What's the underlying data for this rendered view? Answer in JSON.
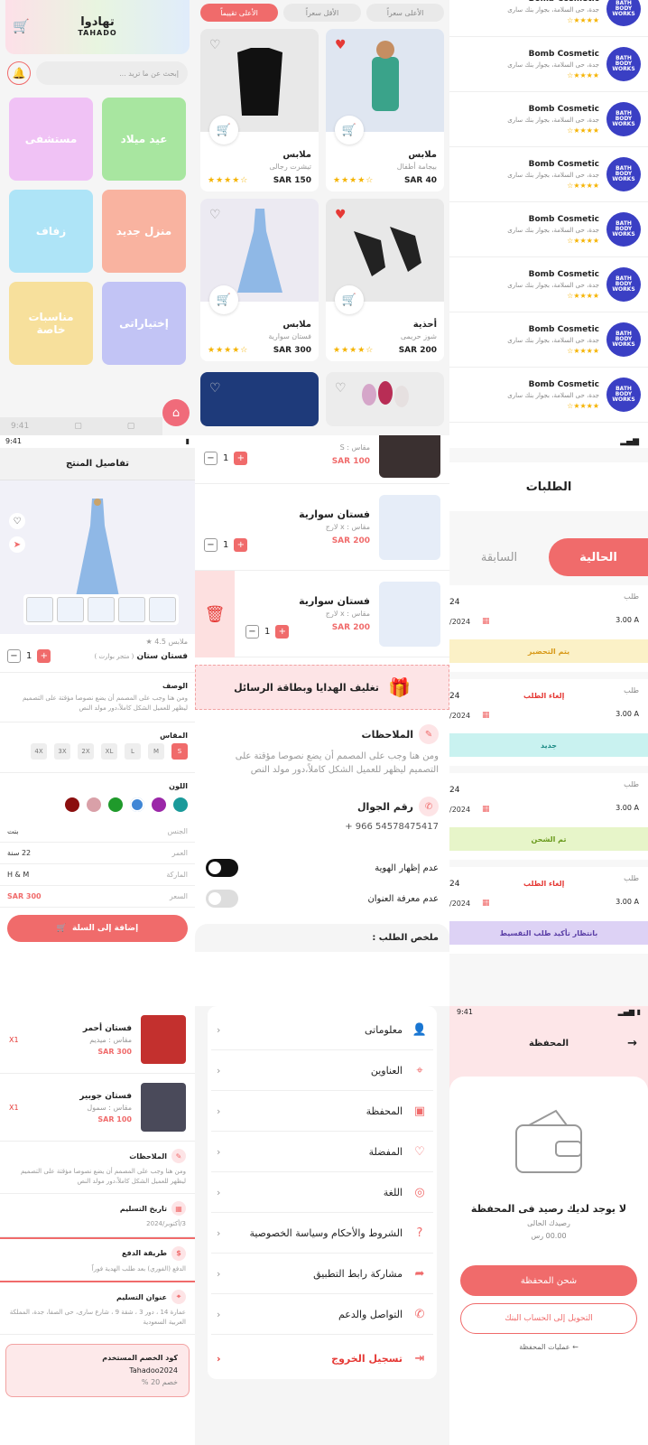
{
  "home": {
    "logo_ar": "تهادوا",
    "logo_en": "TAHADO",
    "search_placeholder": "إبحث عن ما تريد ...",
    "tiles": [
      {
        "label": "عيد ميلاد",
        "color": "#a8e6a0"
      },
      {
        "label": "مستشفى",
        "color": "#f0c2f5"
      },
      {
        "label": "منزل جديد",
        "color": "#f9b3a0"
      },
      {
        "label": "زفاف",
        "color": "#aee4f7"
      },
      {
        "label": "إختياراتى",
        "color": "#c2c4f5"
      },
      {
        "label": "مناسبات خاصة",
        "color": "#f7e09c"
      }
    ],
    "time": "9:41"
  },
  "products": {
    "chips": [
      "الأعلى سعراً",
      "الأقل سعراً",
      "الأعلى تقييماً"
    ],
    "items": [
      {
        "name": "ملابس",
        "sub": "بيجامة أطفال",
        "price": "SAR 40",
        "stars": "★★★★☆",
        "fav": true
      },
      {
        "name": "ملابس",
        "sub": "تيشرت رجالى",
        "price": "SAR 150",
        "stars": "★★★★☆",
        "fav": false
      },
      {
        "name": "أحذية",
        "sub": "شوز حريمى",
        "price": "SAR 200",
        "stars": "★★★★☆",
        "fav": true
      },
      {
        "name": "ملابس",
        "sub": "فستان سوارية",
        "price": "SAR 300",
        "stars": "★★★★☆",
        "fav": false
      }
    ]
  },
  "stores": {
    "name": "Bomb Cosmetic",
    "address": "جدة، حى السلامة، بجوار بنك سارى",
    "logo": "BATH BODY WORKS",
    "stars": "★★★★☆",
    "count": 8
  },
  "detail": {
    "time": "9:41",
    "title": "تفاصيل المنتج",
    "rating": "ملابس 4.5 ★",
    "product_name": "فستان ستان",
    "product_store": "( متجر بوارت )",
    "qty": "1",
    "desc_title": "الوصف",
    "desc": "ومن هنا وجب على المصمم أن يضع نصوصا مؤقتة على التصميم ليظهر للعميل الشكل كاملاً،دور مولد النص",
    "size_title": "المقاس",
    "sizes": [
      "S",
      "M",
      "L",
      "XL",
      "2X",
      "3X",
      "4X"
    ],
    "color_title": "اللون",
    "colors": [
      "#1a9a9a",
      "#9b27a8",
      "#3f86d6",
      "#1f9a2b",
      "#d9a0a8",
      "#8b0f0f"
    ],
    "attrs": [
      {
        "k": "الجنس",
        "v": "بنت"
      },
      {
        "k": "العمر",
        "v": "22 سنة"
      },
      {
        "k": "الماركة",
        "v": "H & M"
      },
      {
        "k": "السعر",
        "v": "SAR 300"
      }
    ],
    "add_button": "إضافة إلى السلة"
  },
  "cart": {
    "items": [
      {
        "name": "",
        "sub": "مقاس : S",
        "price": "SAR 100",
        "qty": "1"
      },
      {
        "name": "فستان سوارية",
        "sub": "مقاس : x لارج",
        "price": "SAR 200",
        "qty": "1"
      },
      {
        "name": "فستان سوارية",
        "sub": "مقاس : x لارج",
        "price": "SAR 200",
        "qty": "1"
      }
    ],
    "gift": "تغليف الهدايا وبطاقة الرسائل",
    "notes_title": "الملاحظات",
    "notes": "ومن هنا وجب على المصمم أن يضع نصوصا مؤقتة على التصميم ليظهر للعميل الشكل كاملاً،دور مولد النص",
    "phone_title": "رقم الجوال",
    "phone": "+ 966 54578475417",
    "hide_identity": "عدم إظهار الهوية",
    "unknown_address": "عدم معرفة العنوان",
    "summary_title": "ملخص الطلب :"
  },
  "orders": {
    "time": "",
    "title": "الطلبات",
    "tabs": [
      "الحالية",
      "السابقة"
    ],
    "cards": [
      {
        "label": "طلب",
        "amount": "3.00 A",
        "num": "24",
        "date": "/2024",
        "cancel": "",
        "status": "يتم التحضير",
        "status_bg": "#fbf1c7",
        "status_color": "#d89a1a"
      },
      {
        "label": "طلب",
        "amount": "3.00 A",
        "num": "24",
        "date": "/2024",
        "cancel": "إلغاء الطلب",
        "status": "جديد",
        "status_bg": "#c9f2f0",
        "status_color": "#1c8b85"
      },
      {
        "label": "طلب",
        "amount": "3.00 A",
        "num": "24",
        "date": "/2024",
        "cancel": "",
        "status": "تم الشحن",
        "status_bg": "#e7f5c9",
        "status_color": "#6a9a1d"
      },
      {
        "label": "طلب",
        "amount": "3.00 A",
        "num": "24",
        "date": "/2024",
        "cancel": "إلغاء الطلب",
        "status": "بانتظار تأكيد طلب التقسيط",
        "status_bg": "#ddd2f5",
        "status_color": "#5a3ea6"
      }
    ]
  },
  "summary": {
    "items": [
      {
        "name": "فستان أحمر",
        "sub": "مقاس : ميديم",
        "price": "SAR 300",
        "qty": "X1"
      },
      {
        "name": "فستان جوبير",
        "sub": "مقاس : سمول",
        "price": "SAR 100",
        "qty": "X1"
      }
    ],
    "notes_title": "الملاحظات",
    "notes": "ومن هنا وجب على المصمم أن يضع نصوصا مؤقتة على التصميم ليظهر للعميل الشكل كاملاً،دور مولد النص",
    "delivery_title": "تاريخ التسليم",
    "delivery": "3/أكتوبر/2024",
    "payment_title": "طريقة الدفع",
    "payment": "الدفع (الفوري) بعد طلب الهدية فوراً",
    "address_title": "عنوان التسليم",
    "address": "عمارة 14 ، دور 3 ، شقة 9 ، شارع سارى، حى الصفا، جدة، المملكة العربية السعودية",
    "coupon_title": "كود الخصم المستخدم",
    "coupon_code": "Tahadoo2024",
    "coupon_discount": "خصم 20 %"
  },
  "menu": {
    "items": [
      {
        "label": "معلوماتى",
        "icon": "👤"
      },
      {
        "label": "العناوين",
        "icon": "⌖"
      },
      {
        "label": "المحفظة",
        "icon": "▣"
      },
      {
        "label": "المفضلة",
        "icon": "♡"
      },
      {
        "label": "اللغة",
        "icon": "◎"
      },
      {
        "label": "الشروط والأحكام وسياسة الخصوصية",
        "icon": "?"
      },
      {
        "label": "مشاركة رابط التطبيق",
        "icon": "➦"
      },
      {
        "label": "التواصل والدعم",
        "icon": "✆"
      }
    ],
    "logout": "تسجيل الخروج"
  },
  "wallet": {
    "time": "9:41",
    "title": "المحفظة",
    "empty_title": "لا يوجد لديك رصيد فى المحفظة",
    "balance_label": "رصيدك الحالى",
    "balance": "00.00 رس",
    "charge_button": "شحن المحفظة",
    "transfer_button": "التحويل إلى الحساب البنك",
    "operations_link": "عمليات المحفظة ←"
  }
}
